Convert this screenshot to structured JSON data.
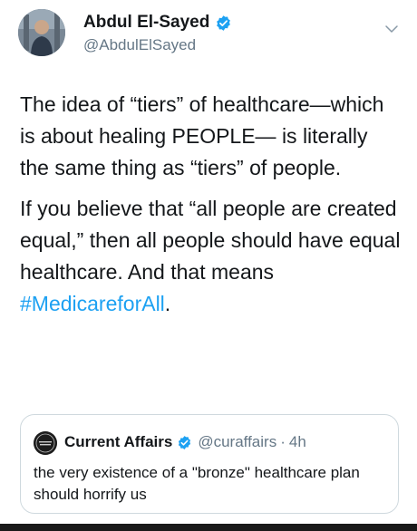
{
  "author": {
    "name": "Abdul El-Sayed",
    "handle": "@AbdulElSayed",
    "avatar_icon": "avatar-photo",
    "verified_icon": "verified-badge-icon"
  },
  "tweet": {
    "paragraph1": "The idea of “tiers” of healthcare—which is about healing PEOPLE— is literally the same thing as “tiers” of people.",
    "paragraph2_text": "If you believe that “all people are created equal,” then all people should have equal healthcare. And that means ",
    "hashtag": "#MedicareforAll",
    "paragraph2_end": "."
  },
  "quote": {
    "name": "Current Affairs",
    "handle": "@curaffairs",
    "separator": "·",
    "time": "4h",
    "text": "the very existence of a \"bronze\" healthcare plan should horrify us"
  },
  "colors": {
    "accent": "#1da1f2",
    "secondary_text": "#657786",
    "border": "#cfd9de"
  }
}
